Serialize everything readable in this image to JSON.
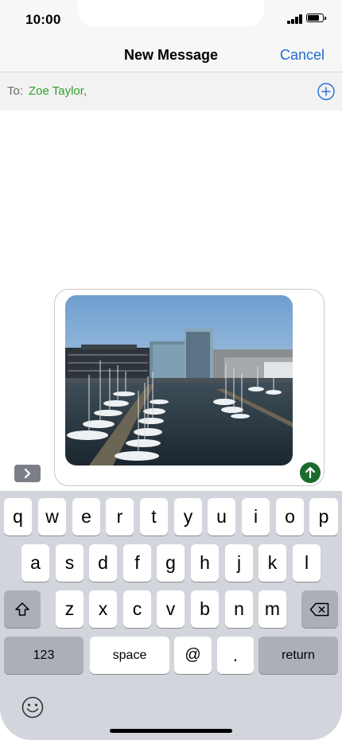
{
  "status_bar": {
    "time": "10:00",
    "battery_level": 0.85
  },
  "nav": {
    "title": "New Message",
    "cancel_label": "Cancel"
  },
  "recipients": {
    "to_label": "To:",
    "recipient_name": "Zoe Taylor",
    "separator": ","
  },
  "attachment": {
    "type": "photo",
    "scene": "harbor-with-sailboats-and-buildings"
  },
  "keyboard": {
    "row1": [
      "q",
      "w",
      "e",
      "r",
      "t",
      "y",
      "u",
      "i",
      "o",
      "p"
    ],
    "row2": [
      "a",
      "s",
      "d",
      "f",
      "g",
      "h",
      "j",
      "k",
      "l"
    ],
    "row3": [
      "z",
      "x",
      "c",
      "v",
      "b",
      "n",
      "m"
    ],
    "numbers_label": "123",
    "space_label": "space",
    "at_label": "@",
    "period_label": ".",
    "return_label": "return"
  },
  "icons": {
    "add_contact": "plus-circle-icon",
    "send": "arrow-up-icon",
    "expand": "chevron-right-icon",
    "shift": "shift-arrow-icon",
    "delete": "backspace-icon",
    "emoji": "smiley-face-icon"
  },
  "colors": {
    "accent": "#1f6bd6",
    "recipient": "#2ba42b",
    "send": "#1b6b2d"
  }
}
